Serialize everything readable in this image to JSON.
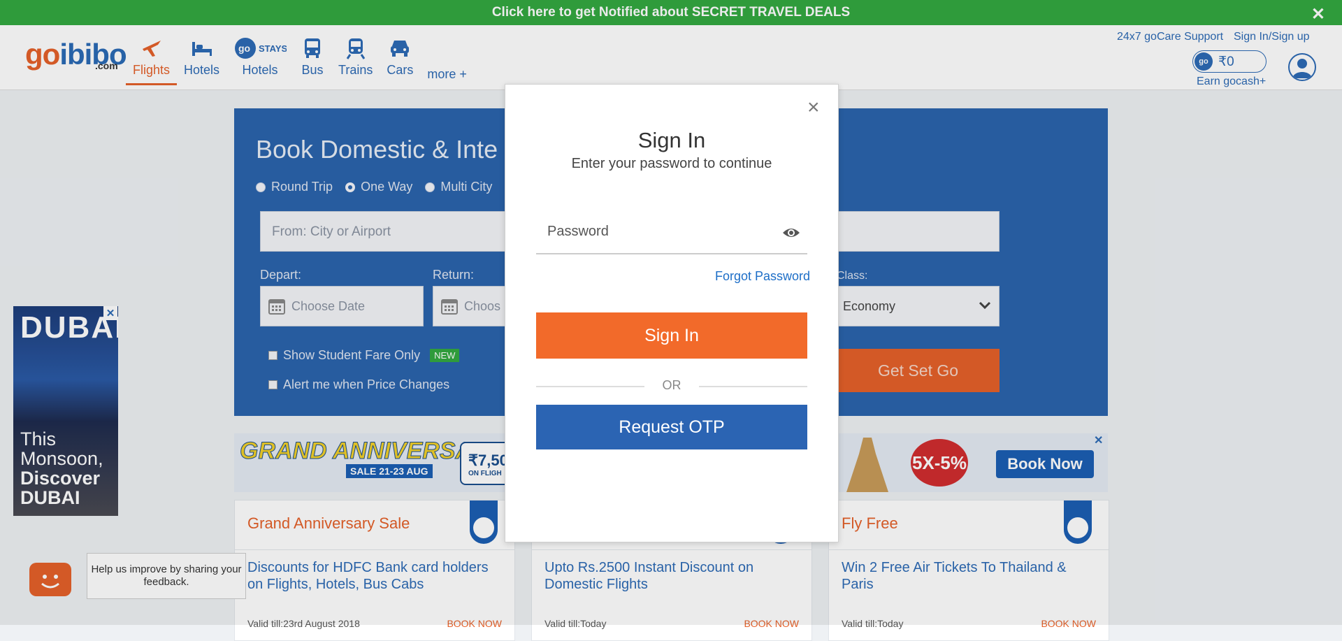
{
  "topbar": {
    "text": "Click here to get Notified about SECRET TRAVEL DEALS",
    "close": "✕"
  },
  "header": {
    "logo_go": "go",
    "logo_ibibo": "ibibo",
    "logo_com": ".com",
    "nav": [
      {
        "label": "Flights",
        "icon": "plane-icon",
        "active": true
      },
      {
        "label": "Hotels",
        "icon": "bed-icon"
      },
      {
        "label": "Hotels",
        "icon": "gostays-icon"
      },
      {
        "label": "Bus",
        "icon": "bus-icon"
      },
      {
        "label": "Trains",
        "icon": "train-icon"
      },
      {
        "label": "Cars",
        "icon": "car-icon"
      }
    ],
    "gostays_text": "go",
    "gostays_stays": "STAYS",
    "more": "more +",
    "support": "24x7 goCare Support",
    "signin_signup": "Sign In/Sign up",
    "gocash_icon_text": "go",
    "gocash_amount": "₹0",
    "earn": "Earn gocash+"
  },
  "search": {
    "title": "Book Domestic & Inte",
    "radios": [
      "Round Trip",
      "One Way",
      "Multi City"
    ],
    "from_placeholder": "From: City or Airport",
    "depart_label": "Depart:",
    "return_label": "Return:",
    "depart_placeholder": "Choose Date",
    "return_placeholder": "Choos",
    "class_label": "Class:",
    "class_value": "Economy",
    "student_fare": "Show Student Fare Only",
    "new_badge": "NEW",
    "price_alert": "Alert me when Price Changes",
    "submit": "Get Set Go"
  },
  "banner": {
    "grand": "GRAND ANNIVERSARY",
    "sale": "SALE 21-23 AUG",
    "price": "₹7,50",
    "price_sub": "ON FLIGH",
    "pct": "5X-5%",
    "booknow": "Book Now",
    "close": "✕"
  },
  "cards": [
    {
      "title": "Grand Anniversary Sale",
      "text": "Discounts for HDFC Bank card holders on Flights, Hotels, Bus Cabs",
      "foot": "Valid till:23rd August 2018",
      "book": "BOOK NOW"
    },
    {
      "title": "",
      "text": "Upto Rs.2500 Instant Discount on Domestic Flights",
      "foot": "Valid till:Today",
      "book": "BOOK NOW"
    },
    {
      "title": "Fly Free",
      "text": "Win 2 Free Air Tickets To Thailand & Paris",
      "foot": "Valid till:Today",
      "book": "BOOK NOW"
    }
  ],
  "ad": {
    "dubai": "DUBAI",
    "line1": "This",
    "line2": "Monsoon,",
    "line3": "Discover",
    "line4": "DUBAI",
    "close": "✕"
  },
  "feedback": {
    "tip": "Help us improve by sharing your feedback."
  },
  "modal": {
    "close": "×",
    "title": "Sign In",
    "subtitle": "Enter your password to continue",
    "password_placeholder": "Password",
    "forgot": "Forgot Password",
    "signin": "Sign In",
    "or": "OR",
    "otp": "Request OTP"
  },
  "colors": {
    "accent": "#e5612a",
    "brand_blue": "#2b64ad",
    "green": "#33a940"
  }
}
